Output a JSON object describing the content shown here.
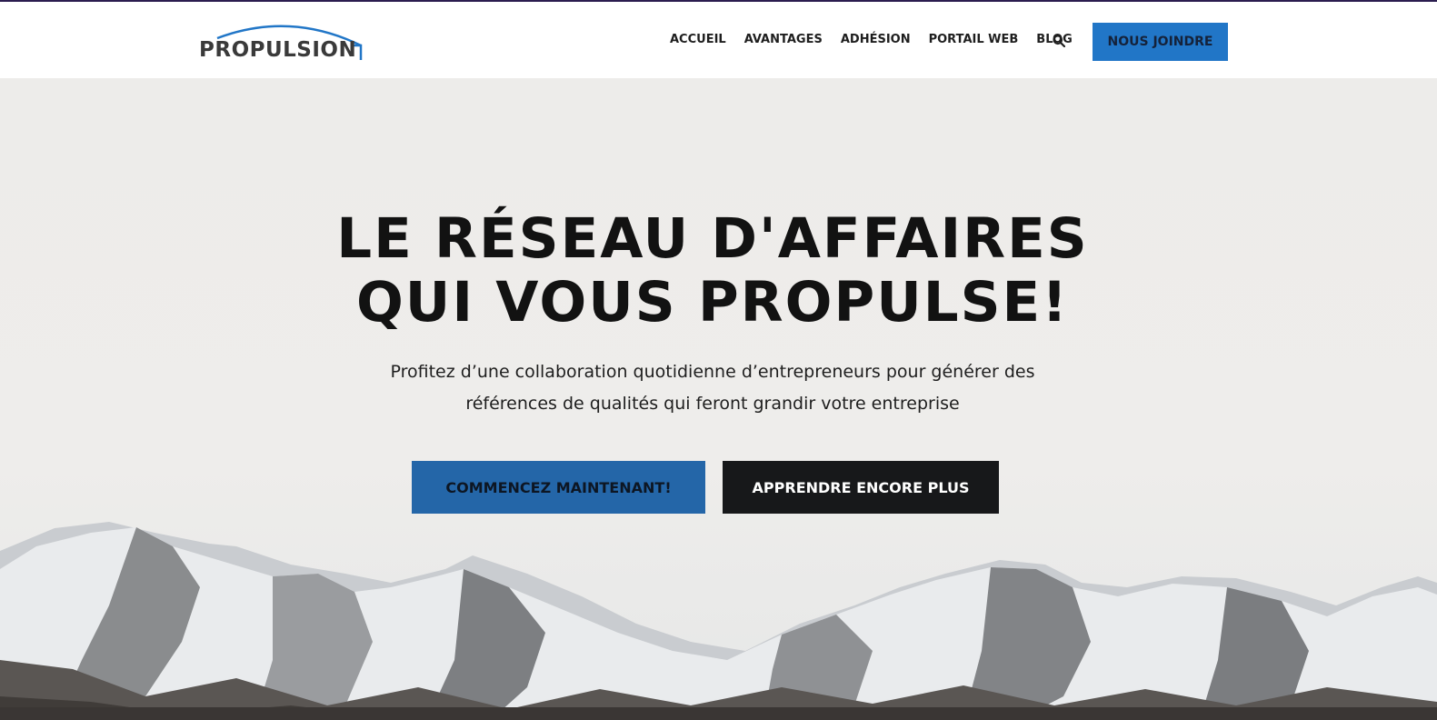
{
  "header": {
    "logo_text": "PROPULSION",
    "nav": [
      "ACCUEIL",
      "AVANTAGES",
      "ADHÉSION",
      "PORTAIL WEB",
      "BLOG"
    ],
    "search_icon": "search-icon",
    "join_label": "NOUS JOINDRE"
  },
  "hero": {
    "title_line1": "LE RÉSEAU D'AFFAIRES",
    "title_line2": "QUI VOUS PROPULSE!",
    "subtitle": "Profitez d’une collaboration quotidienne d’entrepreneurs pour générer des références de qualités qui feront grandir votre entreprise",
    "primary_cta": "COMMENCEZ MAINTENANT!",
    "secondary_cta": "APPRENDRE ENCORE PLUS"
  },
  "colors": {
    "accent": "#2176c7",
    "primary_button": "#2466a8",
    "dark_button": "#17181a",
    "top_bar": "#2b1d4f"
  }
}
